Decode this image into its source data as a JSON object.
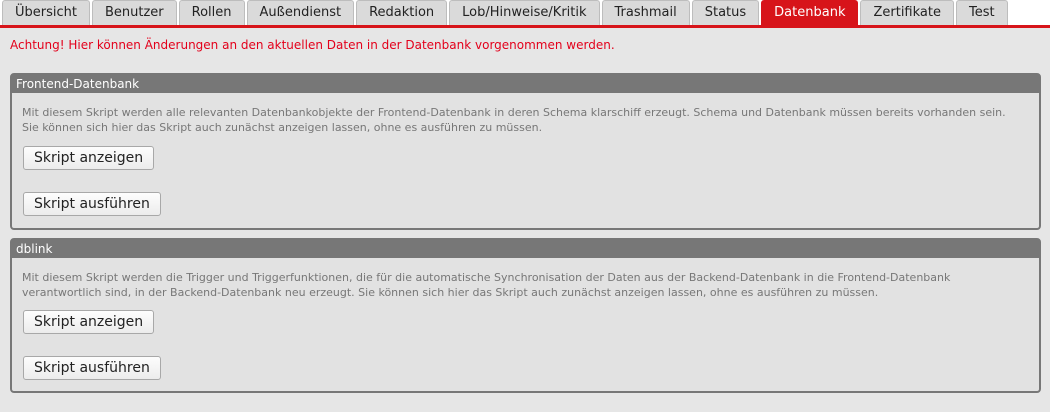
{
  "tabs": [
    {
      "label": "Übersicht",
      "active": false
    },
    {
      "label": "Benutzer",
      "active": false
    },
    {
      "label": "Rollen",
      "active": false
    },
    {
      "label": "Außendienst",
      "active": false
    },
    {
      "label": "Redaktion",
      "active": false
    },
    {
      "label": "Lob/Hinweise/Kritik",
      "active": false
    },
    {
      "label": "Trashmail",
      "active": false
    },
    {
      "label": "Status",
      "active": false
    },
    {
      "label": "Datenbank",
      "active": true
    },
    {
      "label": "Zertifikate",
      "active": false
    },
    {
      "label": "Test",
      "active": false
    }
  ],
  "warning": "Achtung! Hier können Änderungen an den aktuellen Daten in der Datenbank vorgenommen werden.",
  "panels": [
    {
      "title": "Frontend-Datenbank",
      "description": "Mit diesem Skript werden alle relevanten Datenbankobjekte der Frontend-Datenbank in deren Schema klarschiff erzeugt. Schema und Datenbank müssen bereits vorhanden sein. Sie können sich hier das Skript auch zunächst anzeigen lassen, ohne es ausführen zu müssen.",
      "show_label": "Skript anzeigen",
      "run_label": "Skript ausführen"
    },
    {
      "title": "dblink",
      "description": "Mit diesem Skript werden die Trigger und Triggerfunktionen, die für die automatische Synchronisation der Daten aus der Backend-Datenbank in die Frontend-Datenbank verantwortlich sind, in der Backend-Datenbank neu erzeugt. Sie können sich hier das Skript auch zunächst anzeigen lassen, ohne es ausführen zu müssen.",
      "show_label": "Skript anzeigen",
      "run_label": "Skript ausführen"
    }
  ],
  "colors": {
    "accent": "#d7141a",
    "warning_text": "#e3001b",
    "panel_header": "#777777"
  }
}
